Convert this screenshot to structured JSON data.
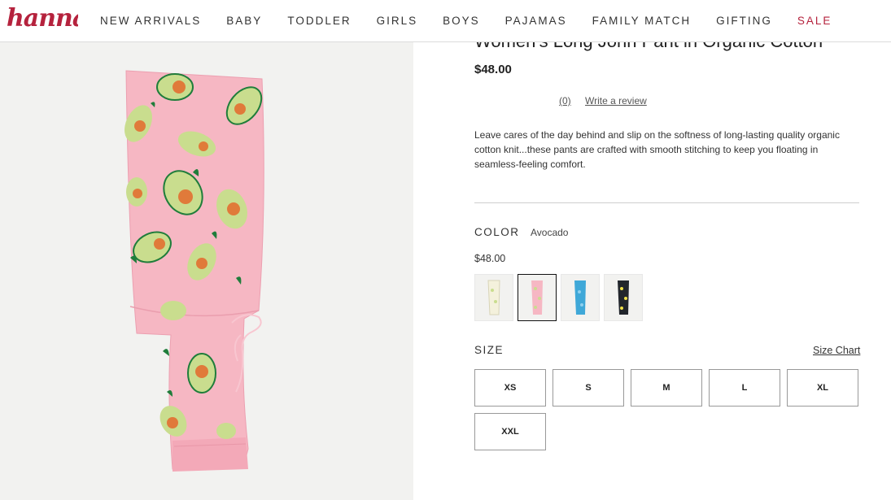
{
  "brand": {
    "logo_text": "hanna"
  },
  "nav": {
    "items": [
      {
        "label": "NEW ARRIVALS"
      },
      {
        "label": "BABY"
      },
      {
        "label": "TODDLER"
      },
      {
        "label": "GIRLS"
      },
      {
        "label": "BOYS"
      },
      {
        "label": "PAJAMAS"
      },
      {
        "label": "FAMILY MATCH"
      },
      {
        "label": "GIFTING"
      },
      {
        "label": "SALE"
      }
    ]
  },
  "product": {
    "title": "Women's Long John Pant in Organic Cotton",
    "price": "$48.00",
    "review_count": "(0)",
    "write_review": "Write a review",
    "description": "Leave cares of the day behind and slip on the softness of long-lasting quality organic cotton knit...these pants are crafted with smooth stitching to keep you floating in seamless-feeling comfort."
  },
  "color": {
    "label": "COLOR",
    "selected_name": "Avocado",
    "swatch_price": "$48.00",
    "swatch_colors": [
      "#f4f1dc",
      "#f6b7c3",
      "#3fa8d8",
      "#22262c"
    ],
    "selected_index": 1
  },
  "size": {
    "label": "SIZE",
    "chart_link": "Size Chart",
    "options": [
      "XS",
      "S",
      "M",
      "L",
      "XL",
      "XXL"
    ]
  },
  "colors": {
    "brand_red": "#b5223d",
    "pant_pink": "#f6b7c3",
    "avocado_green": "#c9dd8e",
    "avocado_pit": "#e07a3a",
    "leaf_green": "#1f7d3b"
  }
}
